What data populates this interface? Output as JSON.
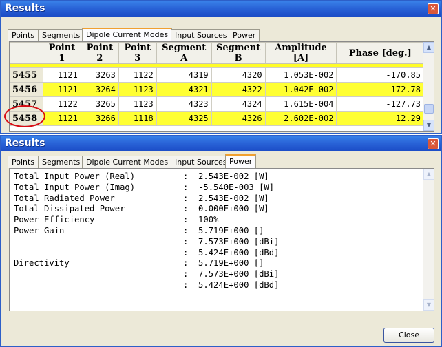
{
  "results_window": {
    "title": "Results",
    "tabs": [
      "Points",
      "Segments",
      "Dipole Current Modes",
      "Input Sources",
      "Power"
    ],
    "active_tab": "Dipole Current Modes",
    "columns": [
      "Point 1",
      "Point 2",
      "Point 3",
      "Segment A",
      "Segment B",
      "Amplitude [A]",
      "Phase [deg.]"
    ],
    "rows": [
      {
        "id": "5455",
        "cells": [
          "1121",
          "3263",
          "1122",
          "4319",
          "4320",
          "1.053E-002",
          "-170.85"
        ],
        "highlighted": false
      },
      {
        "id": "5456",
        "cells": [
          "1121",
          "3264",
          "1123",
          "4321",
          "4322",
          "1.042E-002",
          "-172.78"
        ],
        "highlighted": true
      },
      {
        "id": "5457",
        "cells": [
          "1122",
          "3265",
          "1123",
          "4323",
          "4324",
          "1.615E-004",
          "-127.73"
        ],
        "highlighted": false
      },
      {
        "id": "5458",
        "cells": [
          "1121",
          "3266",
          "1118",
          "4325",
          "4326",
          "2.602E-002",
          "12.29"
        ],
        "highlighted": true
      }
    ],
    "highlight_color": "#ffff33",
    "callout_color": "#d80c14"
  },
  "power_window": {
    "title": "Results",
    "tabs": [
      "Points",
      "Segments",
      "Dipole Current Modes",
      "Input Sources",
      "Power"
    ],
    "active_tab": "Power",
    "lines": [
      {
        "label": "Total Input Power (Real)",
        "sep": ":",
        "value": "2.543E-002 [W]"
      },
      {
        "label": "Total Input Power (Imag)",
        "sep": ":",
        "value": "-5.540E-003 [W]"
      },
      {
        "label": "Total Radiated Power",
        "sep": ":",
        "value": "2.543E-002 [W]"
      },
      {
        "label": "Total Dissipated Power",
        "sep": ":",
        "value": "0.000E+000 [W]"
      },
      {
        "label": "Power Efficiency",
        "sep": ":",
        "value": "100%"
      },
      {
        "label": "Power Gain",
        "sep": ":",
        "value": "5.719E+000 []"
      },
      {
        "label": "",
        "sep": ":",
        "value": "7.573E+000 [dBi]"
      },
      {
        "label": "",
        "sep": ":",
        "value": "5.424E+000 [dBd]"
      },
      {
        "label": "Directivity",
        "sep": ":",
        "value": "5.719E+000 []"
      },
      {
        "label": "",
        "sep": ":",
        "value": "7.573E+000 [dBi]"
      },
      {
        "label": "",
        "sep": ":",
        "value": "5.424E+000 [dBd]"
      }
    ],
    "close_label": "Close"
  },
  "icons": {
    "close": "close-icon",
    "scroll_up": "chevron-up-icon",
    "scroll_down": "chevron-down-icon"
  }
}
